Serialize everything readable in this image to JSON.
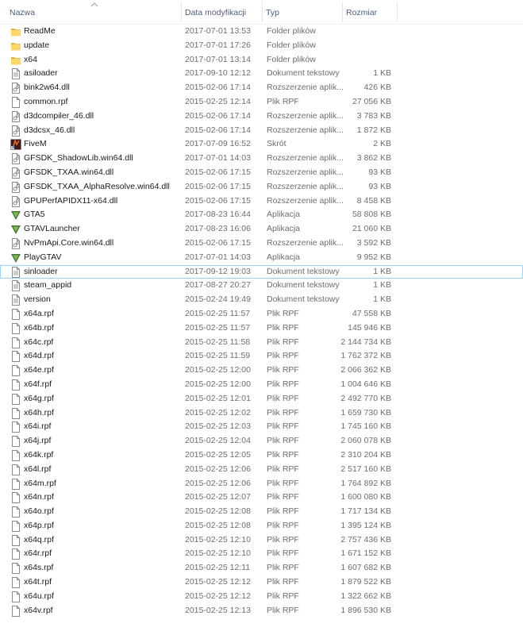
{
  "columns": {
    "name": "Nazwa",
    "date": "Data modyfikacji",
    "type": "Typ",
    "size": "Rozmiar"
  },
  "files": [
    {
      "name": "ReadMe",
      "date": "2017-07-01 13:53",
      "type": "Folder plików",
      "size": "",
      "icon": "folder-icon"
    },
    {
      "name": "update",
      "date": "2017-07-01 17:26",
      "type": "Folder plików",
      "size": "",
      "icon": "folder-icon"
    },
    {
      "name": "x64",
      "date": "2017-07-01 13:14",
      "type": "Folder plików",
      "size": "",
      "icon": "folder-icon"
    },
    {
      "name": "asiloader",
      "date": "2017-09-10 12:12",
      "type": "Dokument tekstowy",
      "size": "1 KB",
      "icon": "text-file-icon"
    },
    {
      "name": "bink2w64.dll",
      "date": "2015-02-06 17:14",
      "type": "Rozszerzenie aplik...",
      "size": "426 KB",
      "icon": "dll-file-icon"
    },
    {
      "name": "common.rpf",
      "date": "2015-02-25 12:14",
      "type": "Plik RPF",
      "size": "27 056 KB",
      "icon": "blank-file-icon"
    },
    {
      "name": "d3dcompiler_46.dll",
      "date": "2015-02-06 17:14",
      "type": "Rozszerzenie aplik...",
      "size": "3 783 KB",
      "icon": "dll-file-icon"
    },
    {
      "name": "d3dcsx_46.dll",
      "date": "2015-02-06 17:14",
      "type": "Rozszerzenie aplik...",
      "size": "1 872 KB",
      "icon": "dll-file-icon"
    },
    {
      "name": "FiveM",
      "date": "2017-07-09 16:52",
      "type": "Skrót",
      "size": "2 KB",
      "icon": "fivem-shortcut-icon"
    },
    {
      "name": "GFSDK_ShadowLib.win64.dll",
      "date": "2017-07-01 14:03",
      "type": "Rozszerzenie aplik...",
      "size": "3 862 KB",
      "icon": "dll-file-icon"
    },
    {
      "name": "GFSDK_TXAA.win64.dll",
      "date": "2015-02-06 17:15",
      "type": "Rozszerzenie aplik...",
      "size": "93 KB",
      "icon": "dll-file-icon"
    },
    {
      "name": "GFSDK_TXAA_AlphaResolve.win64.dll",
      "date": "2015-02-06 17:15",
      "type": "Rozszerzenie aplik...",
      "size": "93 KB",
      "icon": "dll-file-icon"
    },
    {
      "name": "GPUPerfAPIDX11-x64.dll",
      "date": "2015-02-06 17:15",
      "type": "Rozszerzenie aplik...",
      "size": "8 458 KB",
      "icon": "dll-file-icon"
    },
    {
      "name": "GTA5",
      "date": "2017-08-23 16:44",
      "type": "Aplikacja",
      "size": "58 808 KB",
      "icon": "gta-v-app-icon"
    },
    {
      "name": "GTAVLauncher",
      "date": "2017-08-23 16:06",
      "type": "Aplikacja",
      "size": "21 060 KB",
      "icon": "gta-v-app-icon"
    },
    {
      "name": "NvPmApi.Core.win64.dll",
      "date": "2015-02-06 17:15",
      "type": "Rozszerzenie aplik...",
      "size": "3 592 KB",
      "icon": "dll-file-icon"
    },
    {
      "name": "PlayGTAV",
      "date": "2017-07-01 14:03",
      "type": "Aplikacja",
      "size": "9 952 KB",
      "icon": "gta-v-app-icon"
    },
    {
      "name": "sinloader",
      "date": "2017-09-12 19:03",
      "type": "Dokument tekstowy",
      "size": "1 KB",
      "icon": "text-file-icon",
      "selected": true
    },
    {
      "name": "steam_appid",
      "date": "2017-08-27 20:27",
      "type": "Dokument tekstowy",
      "size": "1 KB",
      "icon": "text-file-icon"
    },
    {
      "name": "version",
      "date": "2015-02-24 19:49",
      "type": "Dokument tekstowy",
      "size": "1 KB",
      "icon": "text-file-icon"
    },
    {
      "name": "x64a.rpf",
      "date": "2015-02-25 11:57",
      "type": "Plik RPF",
      "size": "47 558 KB",
      "icon": "blank-file-icon"
    },
    {
      "name": "x64b.rpf",
      "date": "2015-02-25 11:57",
      "type": "Plik RPF",
      "size": "145 946 KB",
      "icon": "blank-file-icon"
    },
    {
      "name": "x64c.rpf",
      "date": "2015-02-25 11:58",
      "type": "Plik RPF",
      "size": "2 144 734 KB",
      "icon": "blank-file-icon"
    },
    {
      "name": "x64d.rpf",
      "date": "2015-02-25 11:59",
      "type": "Plik RPF",
      "size": "1 762 372 KB",
      "icon": "blank-file-icon"
    },
    {
      "name": "x64e.rpf",
      "date": "2015-02-25 12:00",
      "type": "Plik RPF",
      "size": "2 066 362 KB",
      "icon": "blank-file-icon"
    },
    {
      "name": "x64f.rpf",
      "date": "2015-02-25 12:00",
      "type": "Plik RPF",
      "size": "1 004 646 KB",
      "icon": "blank-file-icon"
    },
    {
      "name": "x64g.rpf",
      "date": "2015-02-25 12:01",
      "type": "Plik RPF",
      "size": "2 492 770 KB",
      "icon": "blank-file-icon"
    },
    {
      "name": "x64h.rpf",
      "date": "2015-02-25 12:02",
      "type": "Plik RPF",
      "size": "1 659 730 KB",
      "icon": "blank-file-icon"
    },
    {
      "name": "x64i.rpf",
      "date": "2015-02-25 12:03",
      "type": "Plik RPF",
      "size": "1 745 160 KB",
      "icon": "blank-file-icon"
    },
    {
      "name": "x64j.rpf",
      "date": "2015-02-25 12:04",
      "type": "Plik RPF",
      "size": "2 060 078 KB",
      "icon": "blank-file-icon"
    },
    {
      "name": "x64k.rpf",
      "date": "2015-02-25 12:05",
      "type": "Plik RPF",
      "size": "2 310 204 KB",
      "icon": "blank-file-icon"
    },
    {
      "name": "x64l.rpf",
      "date": "2015-02-25 12:06",
      "type": "Plik RPF",
      "size": "2 517 160 KB",
      "icon": "blank-file-icon"
    },
    {
      "name": "x64m.rpf",
      "date": "2015-02-25 12:06",
      "type": "Plik RPF",
      "size": "1 764 892 KB",
      "icon": "blank-file-icon"
    },
    {
      "name": "x64n.rpf",
      "date": "2015-02-25 12:07",
      "type": "Plik RPF",
      "size": "1 600 080 KB",
      "icon": "blank-file-icon"
    },
    {
      "name": "x64o.rpf",
      "date": "2015-02-25 12:08",
      "type": "Plik RPF",
      "size": "1 717 134 KB",
      "icon": "blank-file-icon"
    },
    {
      "name": "x64p.rpf",
      "date": "2015-02-25 12:08",
      "type": "Plik RPF",
      "size": "1 395 124 KB",
      "icon": "blank-file-icon"
    },
    {
      "name": "x64q.rpf",
      "date": "2015-02-25 12:10",
      "type": "Plik RPF",
      "size": "2 757 436 KB",
      "icon": "blank-file-icon"
    },
    {
      "name": "x64r.rpf",
      "date": "2015-02-25 12:10",
      "type": "Plik RPF",
      "size": "1 671 152 KB",
      "icon": "blank-file-icon"
    },
    {
      "name": "x64s.rpf",
      "date": "2015-02-25 12:11",
      "type": "Plik RPF",
      "size": "1 607 682 KB",
      "icon": "blank-file-icon"
    },
    {
      "name": "x64t.rpf",
      "date": "2015-02-25 12:12",
      "type": "Plik RPF",
      "size": "1 879 522 KB",
      "icon": "blank-file-icon"
    },
    {
      "name": "x64u.rpf",
      "date": "2015-02-25 12:12",
      "type": "Plik RPF",
      "size": "1 322 662 KB",
      "icon": "blank-file-icon"
    },
    {
      "name": "x64v.rpf",
      "date": "2015-02-25 12:13",
      "type": "Plik RPF",
      "size": "1 896 530 KB",
      "icon": "blank-file-icon"
    }
  ]
}
